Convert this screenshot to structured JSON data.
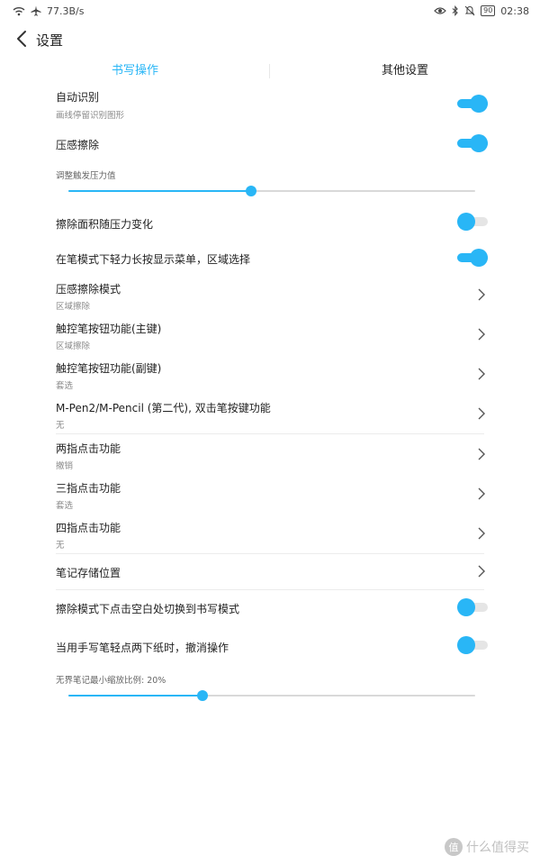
{
  "status_bar": {
    "speed": "77.3B/s",
    "battery": "90",
    "time": "02:38"
  },
  "header": {
    "title": "设置"
  },
  "tabs": [
    {
      "label": "书写操作",
      "active": true
    },
    {
      "label": "其他设置",
      "active": false
    }
  ],
  "settings": {
    "auto_recognize": {
      "label": "自动识别",
      "sub": "画线停留识别图形",
      "enabled": true
    },
    "pressure_erase": {
      "label": "压感擦除",
      "enabled": true
    },
    "pressure_threshold": {
      "label": "调整触发压力值",
      "value": 0.45
    },
    "erase_area_pressure": {
      "label": "擦除面积随压力变化",
      "enabled": false
    },
    "pen_long_press": {
      "label": "在笔模式下轻力长按显示菜单，区域选择",
      "enabled": true
    },
    "pressure_erase_mode": {
      "label": "压感擦除模式",
      "sub": "区域擦除"
    },
    "pen_button_primary": {
      "label": "触控笔按钮功能(主键)",
      "sub": "区域擦除"
    },
    "pen_button_secondary": {
      "label": "触控笔按钮功能(副键)",
      "sub": "套选"
    },
    "mpen_double_tap": {
      "label": "M-Pen2/M-Pencil (第二代), 双击笔按键功能",
      "sub": "无"
    },
    "two_finger_tap": {
      "label": "两指点击功能",
      "sub": "撤销"
    },
    "three_finger_tap": {
      "label": "三指点击功能",
      "sub": "套选"
    },
    "four_finger_tap": {
      "label": "四指点击功能",
      "sub": "无"
    },
    "storage_location": {
      "label": "笔记存储位置"
    },
    "erase_tap_switch": {
      "label": "擦除模式下点击空白处切换到书写模式",
      "enabled": false
    },
    "hand_tap_undo": {
      "label": "当用手写笔轻点两下纸时，撤消操作",
      "enabled": false
    },
    "min_zoom": {
      "label": "无界笔记最小缩放比例: 20%",
      "value": 0.33
    }
  },
  "watermark": {
    "text": "什么值得买",
    "logo": "值"
  },
  "colors": {
    "accent": "#29b6f6",
    "text": "#222222",
    "subtext": "#8a8a8a"
  }
}
